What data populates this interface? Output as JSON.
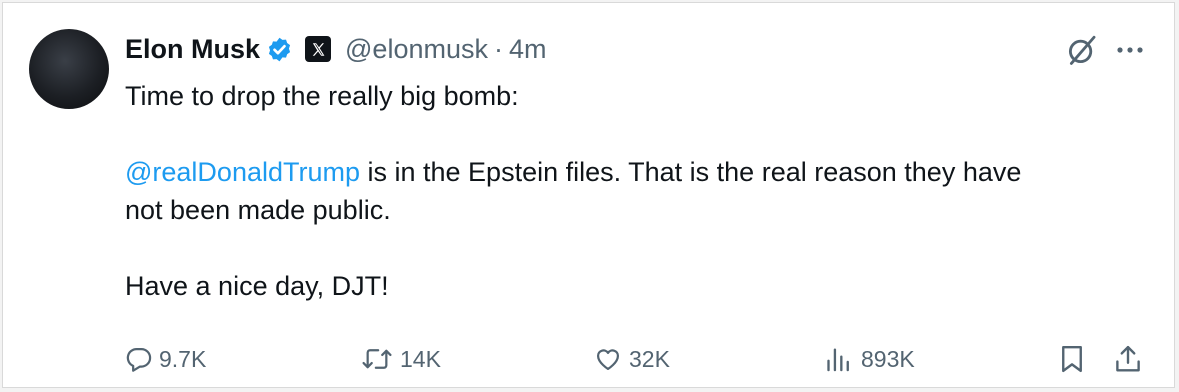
{
  "tweet": {
    "author_name": "Elon Musk",
    "handle": "@elonmusk",
    "separator": "·",
    "time": "4m",
    "line1": "Time to drop the really big bomb:",
    "mention": "@realDonaldTrump",
    "line2_rest": " is in the Epstein files. That is the real reason they have",
    "line3": "not been made public.",
    "line4": "Have a nice day, DJT!"
  },
  "actions": {
    "replies": "9.7K",
    "reposts": "14K",
    "likes": "32K",
    "views": "893K"
  },
  "icons": {
    "verified": "verified-badge-icon",
    "affiliate": "x-logo-icon",
    "grok": "grok-icon",
    "more": "more-icon",
    "reply": "reply-icon",
    "repost": "repost-icon",
    "like": "heart-icon",
    "views": "views-icon",
    "bookmark": "bookmark-icon",
    "share": "share-icon"
  },
  "colors": {
    "link": "#1d9bf0",
    "text": "#0f1419",
    "muted": "#536471",
    "verified": "#1d9bf0"
  }
}
